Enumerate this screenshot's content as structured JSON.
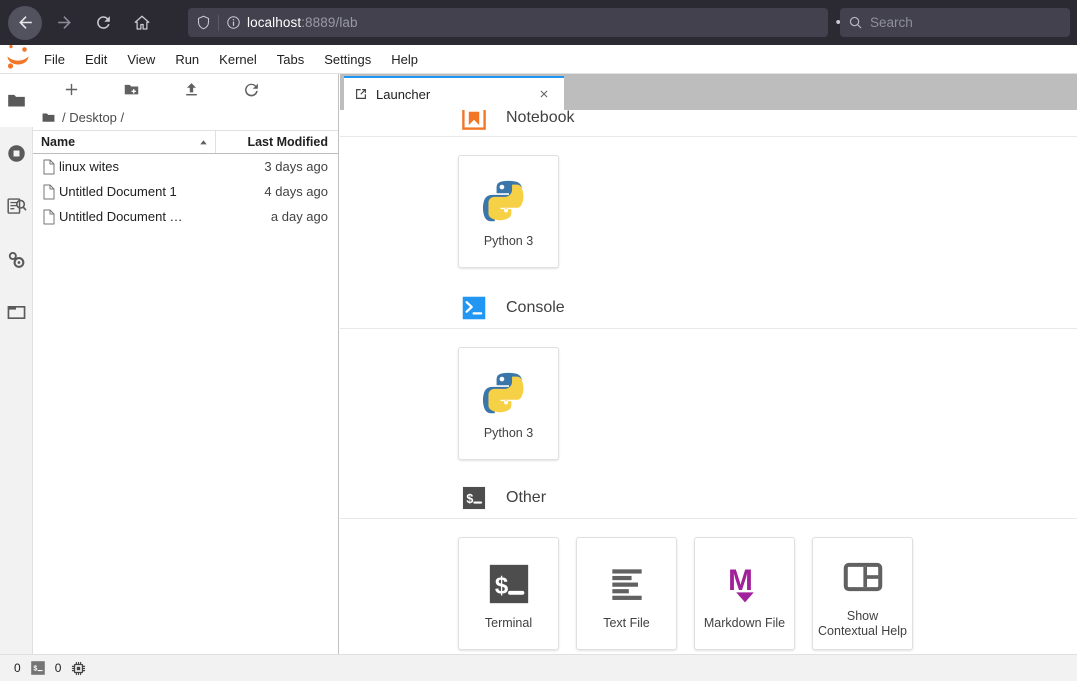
{
  "browser": {
    "nav": {
      "back_label": "Back",
      "forward_label": "Forward",
      "reload_label": "Reload",
      "home_label": "Home"
    },
    "url": {
      "host": "localhost",
      "rest": ":8889/lab",
      "shield_icon": "shield-icon",
      "info_icon": "info-circle-icon"
    },
    "actions": {
      "more_label": "•••",
      "pocket_icon": "pocket-icon",
      "bookmark_icon": "star-icon"
    },
    "search": {
      "placeholder": "Search",
      "icon": "search-icon"
    }
  },
  "menubar": {
    "logo": "jupyter-logo",
    "items": [
      {
        "label": "File"
      },
      {
        "label": "Edit"
      },
      {
        "label": "View"
      },
      {
        "label": "Run"
      },
      {
        "label": "Kernel"
      },
      {
        "label": "Tabs"
      },
      {
        "label": "Settings"
      },
      {
        "label": "Help"
      }
    ]
  },
  "activity_bar": {
    "items": [
      {
        "name": "file-browser",
        "icon": "folder-icon",
        "active": true
      },
      {
        "name": "running-terminals",
        "icon": "stop-circle-icon",
        "active": false
      },
      {
        "name": "command-palette",
        "icon": "palette-search-icon",
        "active": false
      },
      {
        "name": "property-inspector",
        "icon": "gears-icon",
        "active": false
      },
      {
        "name": "open-tabs",
        "icon": "tab-folder-icon",
        "active": false
      }
    ]
  },
  "file_browser": {
    "toolbar": [
      {
        "name": "new-launcher",
        "icon": "plus-icon"
      },
      {
        "name": "new-folder",
        "icon": "new-folder-icon"
      },
      {
        "name": "upload",
        "icon": "upload-icon"
      },
      {
        "name": "refresh",
        "icon": "refresh-icon"
      }
    ],
    "breadcrumb": "/ Desktop /",
    "breadcrumb_icon": "folder-icon",
    "columns": {
      "name": "Name",
      "last_modified": "Last Modified",
      "sort_indicator": "sort-ascending-icon"
    },
    "rows": [
      {
        "icon": "file-icon",
        "name": "linux wites",
        "modified": "3 days ago"
      },
      {
        "icon": "file-icon",
        "name": "Untitled Document 1",
        "modified": "4 days ago"
      },
      {
        "icon": "file-icon",
        "name": "Untitled Document …",
        "modified": "a day ago"
      }
    ]
  },
  "main": {
    "tabs": [
      {
        "label": "Launcher",
        "icon": "launcher-icon",
        "close_icon": "close-icon",
        "active": true
      }
    ]
  },
  "launcher": {
    "sections": [
      {
        "name": "notebook",
        "title": "Notebook",
        "icon": "jupyter-book-icon",
        "cards": [
          {
            "name": "python3-notebook",
            "label": "Python 3",
            "icon": "python-icon"
          }
        ]
      },
      {
        "name": "console",
        "title": "Console",
        "icon": "console-icon",
        "cards": [
          {
            "name": "python3-console",
            "label": "Python 3",
            "icon": "python-icon"
          }
        ]
      },
      {
        "name": "other",
        "title": "Other",
        "icon": "terminal-icon",
        "cards": [
          {
            "name": "terminal",
            "label": "Terminal",
            "icon": "terminal-icon"
          },
          {
            "name": "text-file",
            "label": "Text File",
            "icon": "text-file-icon"
          },
          {
            "name": "markdown-file",
            "label": "Markdown File",
            "icon": "markdown-icon"
          },
          {
            "name": "show-contextual-help",
            "label": "Show Contextual Help",
            "icon": "contextual-help-icon"
          }
        ]
      }
    ]
  },
  "status_bar": {
    "terminals_count": "0",
    "terminal_icon": "terminal-icon",
    "kernels_count": "0",
    "kernel_icon": "cpu-chip-icon"
  },
  "colors": {
    "browser_chrome": "#2b2a33",
    "url_field": "#42414d",
    "tab_accent": "#2196f3",
    "jupyter_orange": "#f37626",
    "console_blue": "#2196f3",
    "terminal_dark": "#4d4d4d",
    "markdown_purple": "#a0219a",
    "panel_gray": "#bdbdbd"
  }
}
